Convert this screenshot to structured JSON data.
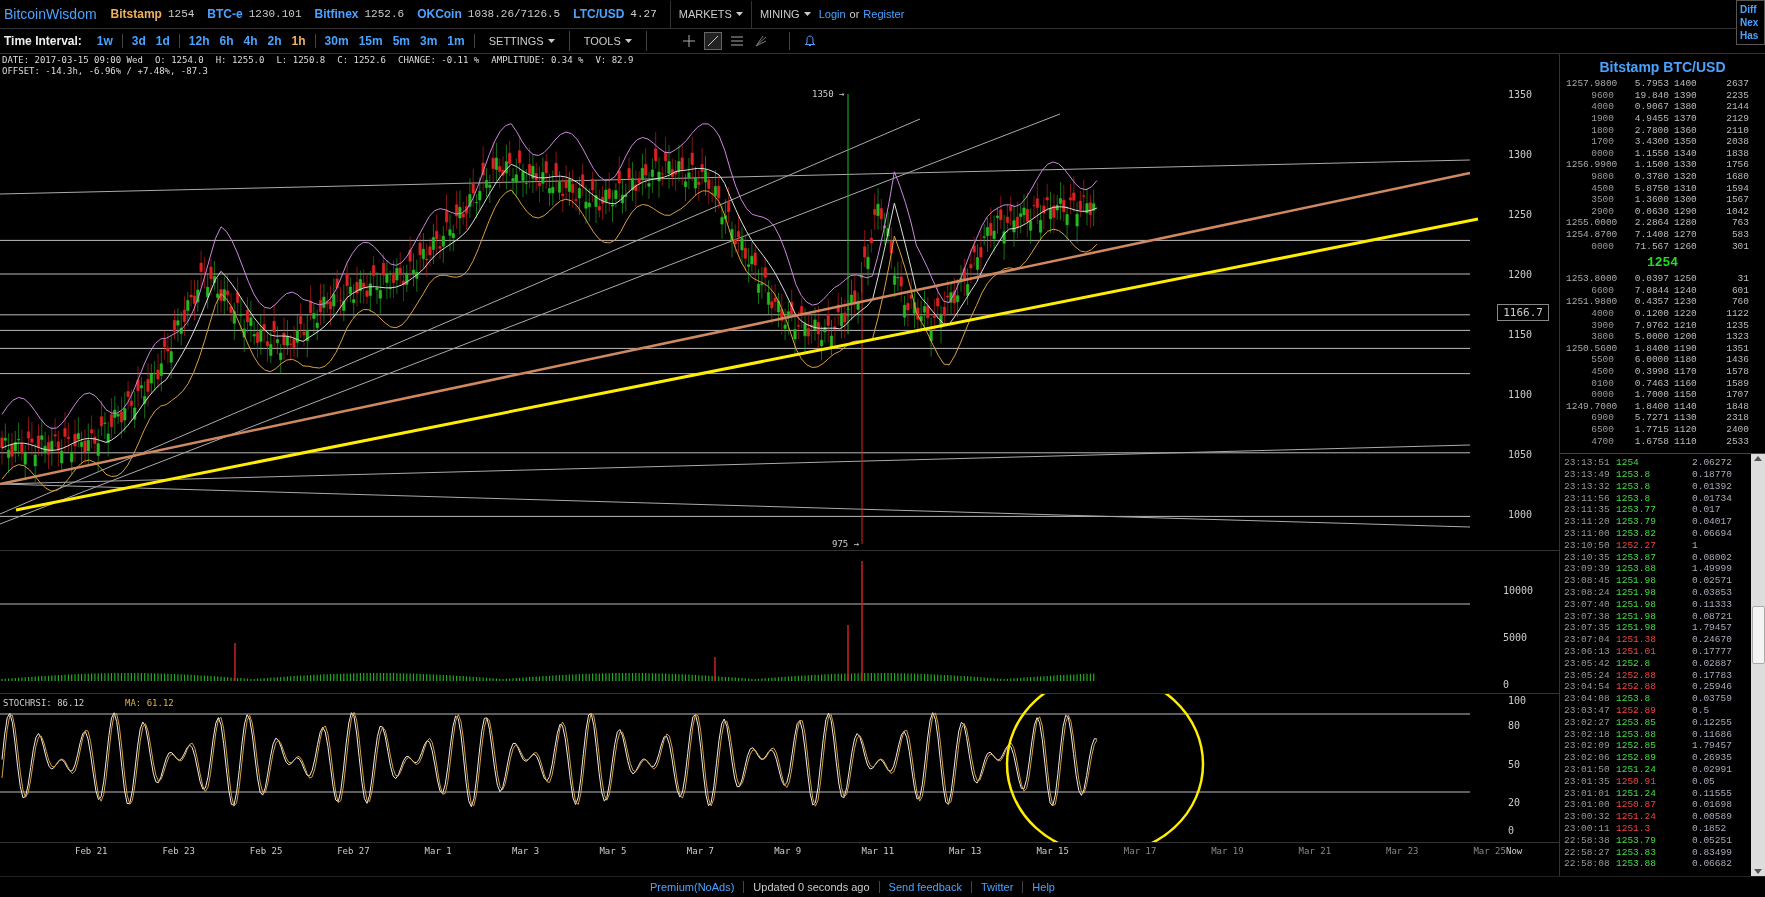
{
  "topbar": {
    "brand": "BitcoinWisdom",
    "exchanges": [
      {
        "name": "Bitstamp",
        "price": "1254",
        "kind": "current"
      },
      {
        "name": "BTC-e",
        "price": "1230.101",
        "kind": "other"
      },
      {
        "name": "Bitfinex",
        "price": "1252.6",
        "kind": "other"
      },
      {
        "name": "OKCoin",
        "price": "1038.26/7126.5",
        "kind": "other"
      },
      {
        "name": "LTC/USD",
        "price": "4.27",
        "kind": "other"
      }
    ],
    "menus": [
      "MARKETS",
      "MINING"
    ],
    "login": "Login",
    "or": "or",
    "register": "Register",
    "mining_box": [
      "Diff",
      "Nex",
      "Has"
    ]
  },
  "toolbar": {
    "label": "Time Interval:",
    "intervals": [
      [
        {
          "label": "1w",
          "selected": false
        }
      ],
      [
        {
          "label": "3d",
          "selected": false
        },
        {
          "label": "1d",
          "selected": false
        }
      ],
      [
        {
          "label": "12h",
          "selected": false
        },
        {
          "label": "6h",
          "selected": false
        },
        {
          "label": "4h",
          "selected": false
        },
        {
          "label": "2h",
          "selected": false
        },
        {
          "label": "1h",
          "selected": true
        }
      ],
      [
        {
          "label": "30m",
          "selected": false
        },
        {
          "label": "15m",
          "selected": false
        },
        {
          "label": "5m",
          "selected": false
        },
        {
          "label": "3m",
          "selected": false
        },
        {
          "label": "1m",
          "selected": false
        }
      ]
    ],
    "menus": [
      "SETTINGS",
      "TOOLS"
    ]
  },
  "info": {
    "line_1": [
      "DATE: 2017-03-15 09:00 Wed",
      "O: 1254.0",
      "H: 1255.0",
      "L: 1250.8",
      "C: 1252.6",
      "CHANGE: -0.11 %",
      "AMPLITUDE: 0.34 %",
      "V: 82.9"
    ],
    "line_2": "OFFSET: -14.3h, -6.96% / +7.48%, -87.3"
  },
  "chart": {
    "price_ticks": [
      "1350",
      "1300",
      "1250",
      "1200",
      "1150",
      "1100",
      "1050",
      "1000"
    ],
    "high_marker": "1350 →",
    "low_marker": "975 →",
    "price_tag": "1166.7",
    "volume_ticks": [
      "10000",
      "5000",
      "0"
    ],
    "stoch_label": "STOCHRSI: 86.12",
    "ma_label": "MA: 61.12",
    "stoch_ticks": [
      "100",
      "80",
      "50",
      "20",
      "0"
    ],
    "x_labels": [
      "Feb 21",
      "Feb 23",
      "Feb 25",
      "Feb 27",
      "Mar 1",
      "Mar 3",
      "Mar 5",
      "Mar 7",
      "Mar 9",
      "Mar 11",
      "Mar 13",
      "Mar 15",
      "Mar 17",
      "Mar 19",
      "Mar 21",
      "Mar 23",
      "Mar 25"
    ],
    "now_label": "Now"
  },
  "orderbook": {
    "title": "Bitstamp BTC/USD",
    "asks": [
      [
        "1257.9800",
        "5.7953",
        "1400",
        "2637"
      ],
      [
        "9600",
        "19.840",
        "1390",
        "2235"
      ],
      [
        "4000",
        "0.9067",
        "1380",
        "2144"
      ],
      [
        "1900",
        "4.9455",
        "1370",
        "2129"
      ],
      [
        "1800",
        "2.7800",
        "1360",
        "2110"
      ],
      [
        "1700",
        "3.4300",
        "1350",
        "2038"
      ],
      [
        "0000",
        "1.1550",
        "1340",
        "1838"
      ],
      [
        "1256.9900",
        "1.1500",
        "1330",
        "1756"
      ],
      [
        "9800",
        "0.3780",
        "1320",
        "1680"
      ],
      [
        "4500",
        "5.8750",
        "1310",
        "1594"
      ],
      [
        "3500",
        "1.3600",
        "1300",
        "1567"
      ],
      [
        "2900",
        "0.0630",
        "1290",
        "1042"
      ],
      [
        "1255.0000",
        "2.2864",
        "1280",
        "763"
      ],
      [
        "1254.8700",
        "7.1408",
        "1270",
        "583"
      ],
      [
        "0000",
        "71.567",
        "1260",
        "301"
      ]
    ],
    "last": "1254",
    "bids": [
      [
        "1253.8000",
        "0.0397",
        "1250",
        "31"
      ],
      [
        "6600",
        "7.0844",
        "1240",
        "601"
      ],
      [
        "1251.9800",
        "0.4357",
        "1230",
        "760"
      ],
      [
        "4000",
        "0.1200",
        "1220",
        "1122"
      ],
      [
        "3900",
        "7.9762",
        "1210",
        "1235"
      ],
      [
        "3800",
        "5.0000",
        "1200",
        "1323"
      ],
      [
        "1250.5600",
        "1.8400",
        "1190",
        "1351"
      ],
      [
        "5500",
        "6.0000",
        "1180",
        "1436"
      ],
      [
        "4500",
        "0.3998",
        "1170",
        "1578"
      ],
      [
        "0100",
        "0.7463",
        "1160",
        "1589"
      ],
      [
        "0000",
        "1.7000",
        "1150",
        "1707"
      ],
      [
        "1249.7000",
        "1.8400",
        "1140",
        "1848"
      ],
      [
        "6900",
        "5.7271",
        "1130",
        "2318"
      ],
      [
        "6500",
        "1.7715",
        "1120",
        "2400"
      ],
      [
        "4700",
        "1.6758",
        "1110",
        "2533"
      ]
    ]
  },
  "trades": [
    {
      "time": "23:13:51",
      "price": "1254",
      "amount": "2.06272",
      "down": false
    },
    {
      "time": "23:13:49",
      "price": "1253.8",
      "amount": "0.18770",
      "down": false
    },
    {
      "time": "23:13:32",
      "price": "1253.8",
      "amount": "0.01392",
      "down": false
    },
    {
      "time": "23:11:56",
      "price": "1253.8",
      "amount": "0.01734",
      "down": false
    },
    {
      "time": "23:11:35",
      "price": "1253.77",
      "amount": "0.017",
      "down": false
    },
    {
      "time": "23:11:20",
      "price": "1253.79",
      "amount": "0.04017",
      "down": false
    },
    {
      "time": "23:11:00",
      "price": "1253.82",
      "amount": "0.06694",
      "down": false
    },
    {
      "time": "23:10:50",
      "price": "1252.27",
      "amount": "1",
      "down": true
    },
    {
      "time": "23:10:35",
      "price": "1253.87",
      "amount": "0.08002",
      "down": false
    },
    {
      "time": "23:09:39",
      "price": "1253.88",
      "amount": "1.49999",
      "down": false
    },
    {
      "time": "23:08:45",
      "price": "1251.98",
      "amount": "0.02571",
      "down": false
    },
    {
      "time": "23:08:24",
      "price": "1251.98",
      "amount": "0.03853",
      "down": false
    },
    {
      "time": "23:07:40",
      "price": "1251.98",
      "amount": "0.11333",
      "down": false
    },
    {
      "time": "23:07:38",
      "price": "1251.98",
      "amount": "0.08721",
      "down": false
    },
    {
      "time": "23:07:35",
      "price": "1251.98",
      "amount": "1.79457",
      "down": false
    },
    {
      "time": "23:07:04",
      "price": "1251.38",
      "amount": "0.24670",
      "down": true
    },
    {
      "time": "23:06:13",
      "price": "1251.01",
      "amount": "0.17777",
      "down": true
    },
    {
      "time": "23:05:42",
      "price": "1252.8",
      "amount": "0.02887",
      "down": false
    },
    {
      "time": "23:05:24",
      "price": "1252.88",
      "amount": "0.17783",
      "down": true
    },
    {
      "time": "23:04:54",
      "price": "1252.88",
      "amount": "0.25946",
      "down": true
    },
    {
      "time": "23:04:08",
      "price": "1253.8",
      "amount": "0.03759",
      "down": false
    },
    {
      "time": "23:03:47",
      "price": "1252.89",
      "amount": "0.5",
      "down": true
    },
    {
      "time": "23:02:27",
      "price": "1253.85",
      "amount": "0.12255",
      "down": false
    },
    {
      "time": "23:02:18",
      "price": "1253.88",
      "amount": "0.11686",
      "down": false
    },
    {
      "time": "23:02:09",
      "price": "1252.85",
      "amount": "1.79457",
      "down": false
    },
    {
      "time": "23:02:06",
      "price": "1252.89",
      "amount": "0.26935",
      "down": false
    },
    {
      "time": "23:01:50",
      "price": "1251.24",
      "amount": "0.02991",
      "down": false
    },
    {
      "time": "23:01:35",
      "price": "1250.91",
      "amount": "0.05",
      "down": true
    },
    {
      "time": "23:01:01",
      "price": "1251.24",
      "amount": "0.11555",
      "down": false
    },
    {
      "time": "23:01:00",
      "price": "1250.87",
      "amount": "0.01698",
      "down": true
    },
    {
      "time": "23:00:32",
      "price": "1251.24",
      "amount": "0.00589",
      "down": true
    },
    {
      "time": "23:00:11",
      "price": "1251.3",
      "amount": "0.1852",
      "down": true
    },
    {
      "time": "22:58:38",
      "price": "1253.79",
      "amount": "0.05251",
      "down": false
    },
    {
      "time": "22:58:27",
      "price": "1253.83",
      "amount": "0.83499",
      "down": false
    },
    {
      "time": "22:58:08",
      "price": "1253.88",
      "amount": "0.06682",
      "down": false
    }
  ],
  "footer": [
    "Premium(NoAds)",
    "Updated 0 seconds ago",
    "Send feedback",
    "Twitter",
    "Help"
  ]
}
